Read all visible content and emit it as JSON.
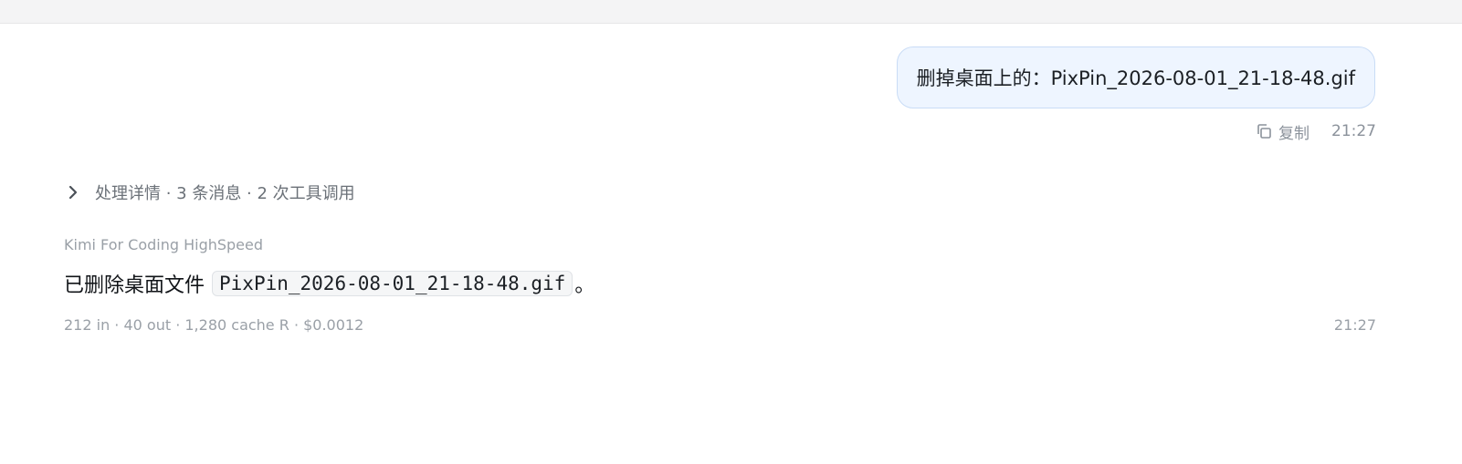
{
  "user_message": {
    "text": "删掉桌面上的：PixPin_2026-08-01_21-18-48.gif",
    "copy_label": "复制",
    "copy_icon": "copy-icon",
    "timestamp": "21:27"
  },
  "details": {
    "label": "处理详情 · 3 条消息 · 2 次工具调用",
    "icon": "chevron-right-icon"
  },
  "assistant": {
    "model_name": "Kimi For Coding HighSpeed",
    "text_before": "已删除桌面文件",
    "code": "PixPin_2026-08-01_21-18-48.gif",
    "text_after": "。",
    "usage": "212 in · 40 out · 1,280 cache R · $0.0012",
    "timestamp": "21:27"
  },
  "colors": {
    "bubble_bg": "#eef5ff",
    "bubble_border": "#c9dcf6",
    "muted_text": "#9aa0a7"
  }
}
